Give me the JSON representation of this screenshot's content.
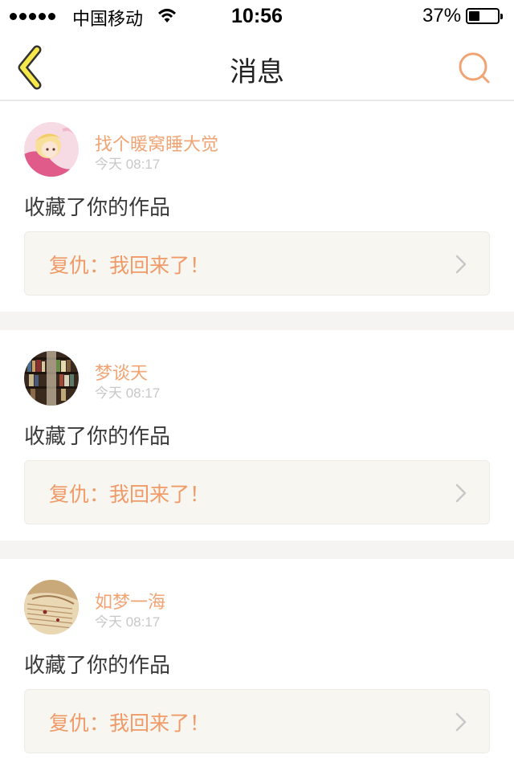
{
  "status_bar": {
    "carrier": "中国移动",
    "time": "10:56",
    "battery_percent": "37%",
    "battery_level": 0.37,
    "icons": [
      "signal-dots-icon",
      "wifi-icon",
      "battery-icon"
    ]
  },
  "nav": {
    "title": "消息",
    "back_icon": "chevron-left-icon",
    "search_icon": "search-icon"
  },
  "colors": {
    "accent": "#f0a474",
    "back_icon_fill": "#f6e84a",
    "card_bg": "#f7f6f0",
    "divider": "#f5f4f2"
  },
  "messages": [
    {
      "user": "找个暖窝睡大觉",
      "time": "今天 08:17",
      "action": "收藏了你的作品",
      "work_title": "复仇：我回来了！",
      "avatar_icon": "anime-girl-avatar"
    },
    {
      "user": "梦谈天",
      "time": "今天 08:17",
      "action": "收藏了你的作品",
      "work_title": "复仇：我回来了！",
      "avatar_icon": "bookshelf-avatar"
    },
    {
      "user": "如梦一海",
      "time": "今天 08:17",
      "action": "收藏了你的作品",
      "work_title": "复仇：我回来了！",
      "avatar_icon": "open-book-avatar"
    }
  ]
}
